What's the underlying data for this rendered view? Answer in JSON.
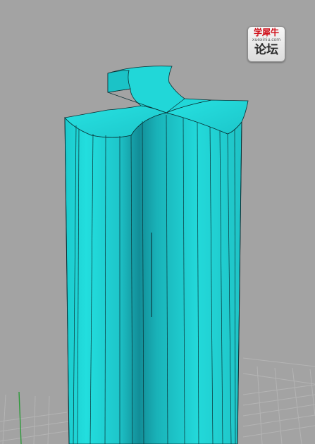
{
  "viewport": {
    "background": "#a3a3a3",
    "grid_color": "#b3b3b3",
    "axis_color": "#2f9a3c",
    "model_fill": "#1fd9d9",
    "model_edge": "#0a2f33"
  },
  "watermark": {
    "line1": "学犀牛",
    "line2": "xuexiniu.com",
    "line3": "论坛"
  }
}
